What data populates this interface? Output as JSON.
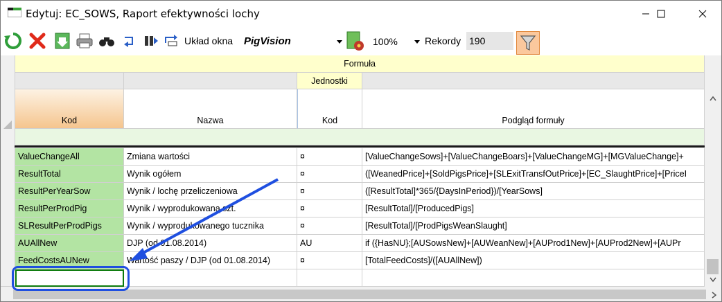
{
  "window": {
    "title": "Edytuj: EC_SOWS, Raport efektywności lochy"
  },
  "toolbar": {
    "layout_label": "Układ okna",
    "layout_value": "PigVision",
    "zoom_value": "100%",
    "records_label": "Rekordy",
    "records_value": "190"
  },
  "grid": {
    "band_formula": "Formuła",
    "band_units": "Jednostki",
    "columns": {
      "kod": "Kod",
      "nazwa": "Nazwa",
      "units_kod": "Kod",
      "preview": "Podgląd formuły"
    },
    "rows": [
      {
        "kod": "ValueChangeAll",
        "nazwa": "Zmiana wartości",
        "unit": "¤",
        "formula": "[ValueChangeSows]+[ValueChangeBoars]+[ValueChangeMG]+[MGValueChange]+"
      },
      {
        "kod": "ResultTotal",
        "nazwa": "Wynik ogółem",
        "unit": "¤",
        "formula": "([WeanedPrice]+[SoldPigsPrice]+[SLExitTransfOutPrice]+[EC_SlaughtPrice]+[PriceI"
      },
      {
        "kod": "ResultPerYearSow",
        "nazwa": "Wynik / lochę przeliczeniowa",
        "unit": "¤",
        "formula": "([ResultTotal]*365/{DaysInPeriod})/[YearSows]"
      },
      {
        "kod": "ResultPerProdPig",
        "nazwa": "Wynik / wyprodukowaną szt.",
        "unit": "¤",
        "formula": "[ResultTotal]/[ProducedPigs]"
      },
      {
        "kod": "SLResultPerProdPigs",
        "nazwa": "Wynik / wyprodukowanego tucznika",
        "unit": "¤",
        "formula": "[ResultTotal]/[ProdPigsWeanSlaught]"
      },
      {
        "kod": "AUAllNew",
        "nazwa": "DJP (od 01.08.2014)",
        "unit": "AU",
        "formula": "if ({HasNU};[AUSowsNew]+[AUWeanNew]+[AUProd1New]+[AUProd2New]+[AUPr"
      },
      {
        "kod": "FeedCostsAUNew",
        "nazwa": "Wartość paszy / DJP (od 01.08.2014)",
        "unit": "¤",
        "formula": "[TotalFeedCosts]/([AUAllNew])"
      }
    ],
    "new_row_value": ""
  },
  "icons": {
    "refresh": "refresh-icon",
    "delete": "delete-icon",
    "save": "save-download-icon",
    "print": "print-icon",
    "find": "binoculars-icon",
    "filter": "filter-funnel-icon"
  },
  "colors": {
    "kod_column": "#b3e4a3",
    "band_formula": "#ffffcc",
    "annotation": "#1f4fe0"
  }
}
